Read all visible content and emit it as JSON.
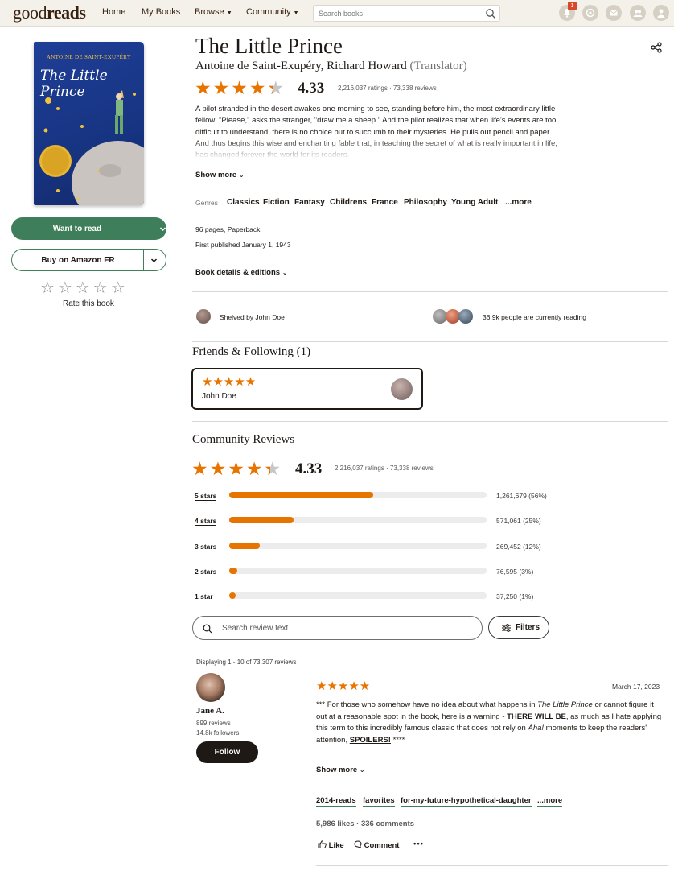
{
  "header": {
    "logo_regular": "good",
    "logo_bold": "reads",
    "nav": [
      "Home",
      "My Books",
      "Browse",
      "Community"
    ],
    "search_placeholder": "Search books",
    "notification_count": "1"
  },
  "sidebar": {
    "cover_author": "ANTOINE DE SAINT-EXUPÉRY",
    "cover_title": "The Little Prince",
    "want_to_read": "Want to read",
    "buy": "Buy on Amazon FR",
    "rate_stars": "☆☆☆☆☆",
    "rate_label": "Rate this book"
  },
  "book": {
    "title": "The Little Prince",
    "author": "Antoine de Saint-Exupéry, Richard Howard",
    "translator_role": "(Translator)",
    "average_rating": "4.33",
    "rating_value": 4.33,
    "ratings_meta": "2,216,037 ratings · 73,338 reviews",
    "description": "A pilot stranded in the desert awakes one morning to see, standing before him, the most extraordinary little fellow. \"Please,\" asks the stranger, \"draw me a sheep.\" And the pilot realizes that when life's events are too difficult to understand, there is no choice but to succumb to their mysteries. He pulls out pencil and paper... And thus begins this wise and enchanting fable that, in teaching the secret of what is really important in life, has changed forever the world for its readers.",
    "show_more": "Show more",
    "genres_label": "Genres",
    "genres": [
      "Classics",
      "Fiction",
      "Fantasy",
      "Childrens",
      "France",
      "Philosophy",
      "Young Adult",
      "...more"
    ],
    "pages": "96 pages, Paperback",
    "first_published": "First published January 1, 1943",
    "details_link": "Book details & editions"
  },
  "social": {
    "shelved_by": "Shelved by John Doe",
    "currently_reading": "36.9k people are currently reading"
  },
  "friends": {
    "heading": "Friends & Following (1)",
    "friend_stars": "★★★★★",
    "friend_name": "John Doe"
  },
  "community": {
    "heading": "Community Reviews",
    "average_rating": "4.33",
    "ratings_meta": "2,216,037 ratings · 73,338 reviews",
    "histogram": [
      {
        "label": "5 stars",
        "value": "1,261,679 (56%)",
        "pct": 56
      },
      {
        "label": "4 stars",
        "value": "571,061 (25%)",
        "pct": 25
      },
      {
        "label": "3 stars",
        "value": "269,452 (12%)",
        "pct": 12
      },
      {
        "label": "2 stars",
        "value": "76,595 (3%)",
        "pct": 3
      },
      {
        "label": "1 star",
        "value": "37,250 (1%)",
        "pct": 1
      }
    ],
    "search_placeholder": "Search review text",
    "filters": "Filters",
    "displaying": "Displaying 1 - 10 of 73,307 reviews"
  },
  "review": {
    "reviewer": "Jane A.",
    "reviews_count": "899 reviews",
    "followers": "14.8k followers",
    "follow": "Follow",
    "stars": "★★★★★",
    "date": "March 17, 2023",
    "body_1": "*** For those who somehow have no idea about what happens in ",
    "body_title": "The Little Prince",
    "body_2": " or cannot figure it out at a reasonable spot in the book, here is a warning - ",
    "body_will": "THERE WILL BE",
    "body_3": ", as much as I hate applying this term to this incredibly famous classic that does not rely on ",
    "body_aha": "Aha!",
    "body_4": " moments to keep the readers' attention, ",
    "body_spoilers": "SPOILERS!",
    "body_5": " ****",
    "show_more": "Show more",
    "tags": [
      "2014-reads",
      "favorites",
      "for-my-future-hypothetical-daughter",
      "...more"
    ],
    "stats": "5,986 likes · 336 comments",
    "like": "Like",
    "comment": "Comment",
    "more": "•••"
  },
  "colors": {
    "accent_green": "#3f7e5b",
    "star_orange": "#e87400",
    "header_bg": "#f4f1ea"
  }
}
